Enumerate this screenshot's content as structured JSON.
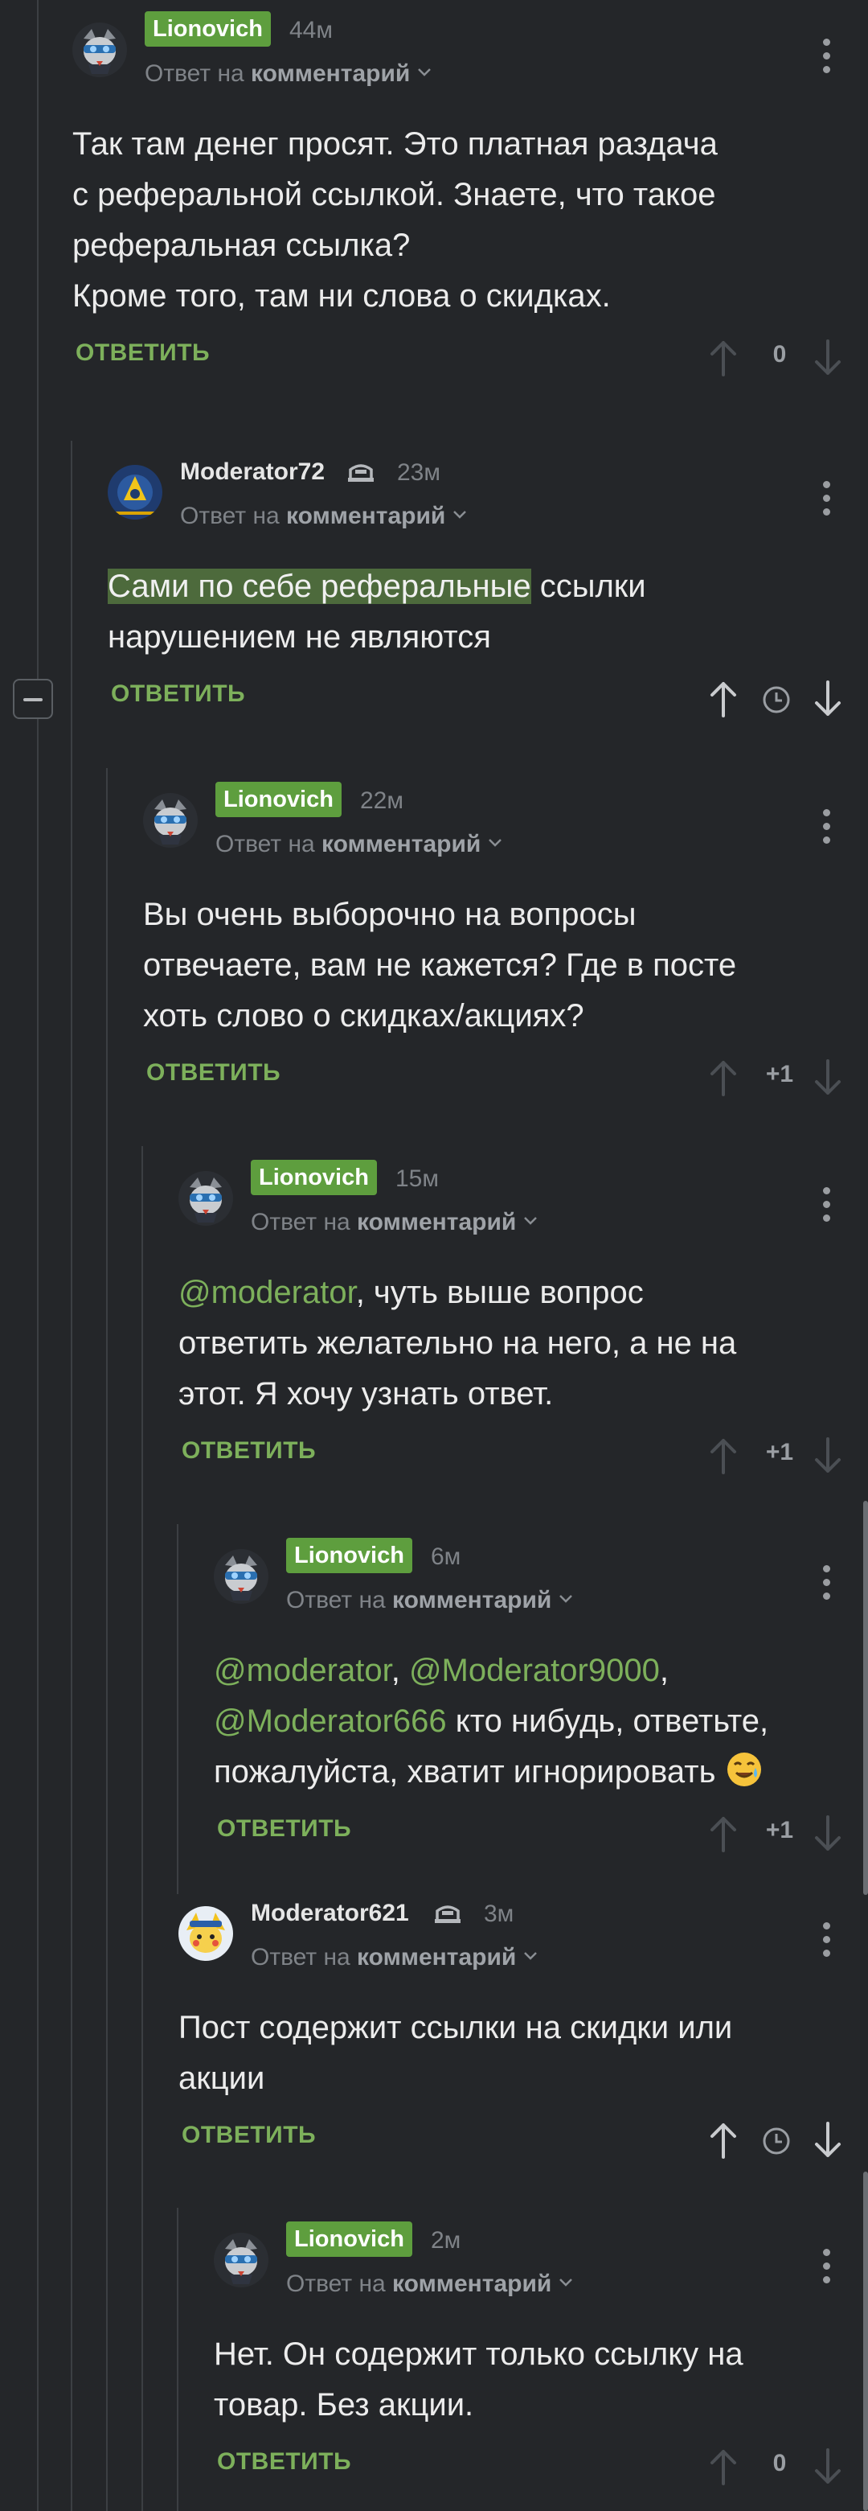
{
  "comments": [
    {
      "user": "Lionovich",
      "time": "44м",
      "reply_prefix": "Ответ на",
      "reply_target": "комментарий",
      "text_lines": [
        "Так там денег просят. Это платная раздача",
        "с реферальной ссылкой. Знаете, что такое",
        "реферальная ссылка?",
        "Кроме того, там ни слова о скидках."
      ],
      "reply_label": "ОТВЕТИТЬ",
      "rating": "0"
    },
    {
      "user": "Moderator72",
      "time": "23м",
      "reply_prefix": "Ответ на",
      "reply_target": "комментарий",
      "text_highlight": "Сами по себе реферальные",
      "text_rest": " ссылки",
      "text_line2": "нарушением не являются",
      "reply_label": "ОТВЕТИТЬ"
    },
    {
      "user": "Lionovich",
      "time": "22м",
      "reply_prefix": "Ответ на",
      "reply_target": "комментарий",
      "text_lines": [
        "Вы очень выборочно на вопросы",
        "отвечаете, вам не кажется? Где в посте",
        "хоть слово о скидках/акциях?"
      ],
      "reply_label": "ОТВЕТИТЬ",
      "rating": "+1"
    },
    {
      "user": "Lionovich",
      "time": "15м",
      "reply_prefix": "Ответ на",
      "reply_target": "комментарий",
      "mention": "@moderator",
      "text_after_mention": ", чуть выше вопрос",
      "text_lines": [
        "ответить желательно на него, а не на",
        "этот. Я хочу узнать ответ."
      ],
      "reply_label": "ОТВЕТИТЬ",
      "rating": "+1"
    },
    {
      "user": "Lionovich",
      "time": "6м",
      "reply_prefix": "Ответ на",
      "reply_target": "комментарий",
      "mention1": "@moderator",
      "sep1": ", ",
      "mention2": "@Moderator9000",
      "sep2": ",",
      "mention3": "@Moderator666",
      "text_after": " кто нибудь, ответьте,",
      "text_last": "пожалуйста, хватит игнорировать ",
      "reply_label": "ОТВЕТИТЬ",
      "rating": "+1"
    },
    {
      "user": "Moderator621",
      "time": "3м",
      "reply_prefix": "Ответ на",
      "reply_target": "комментарий",
      "text_lines": [
        "Пост содержит ссылки на скидки или",
        "акции"
      ],
      "reply_label": "ОТВЕТИТЬ"
    },
    {
      "user": "Lionovich",
      "time": "2м",
      "reply_prefix": "Ответ на",
      "reply_target": "комментарий",
      "text_lines": [
        "Нет. Он содержит только ссылку на",
        "товар. Без акции."
      ],
      "reply_label": "ОТВЕТИТЬ",
      "rating": "0"
    }
  ],
  "colors": {
    "background": "#242629",
    "badge": "#5e9e3e",
    "accent_green": "#7db05b",
    "muted": "#7f8388"
  },
  "icons": [
    "more-vert-icon",
    "chevron-down-icon",
    "arrow-up-icon",
    "arrow-down-icon",
    "clock-icon",
    "moderator-hat-icon",
    "collapse-minus-icon",
    "tear-smile-emoji"
  ]
}
